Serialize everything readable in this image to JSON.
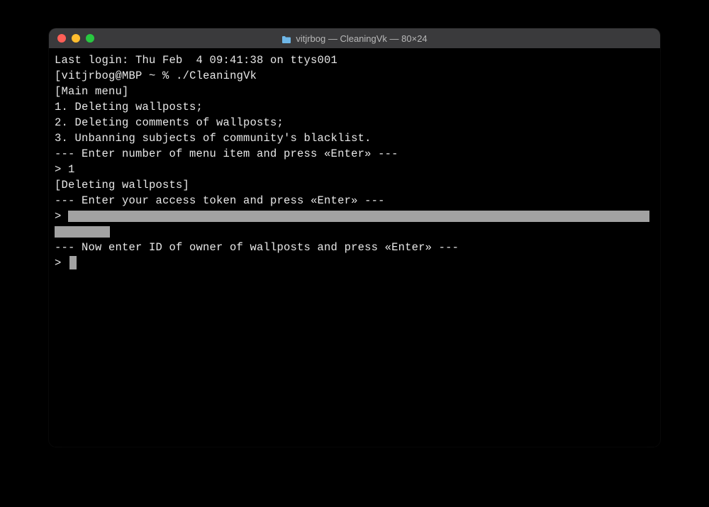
{
  "window": {
    "title": "vitjrbog — CleaningVk — 80×24"
  },
  "terminal": {
    "last_login": "Last login: Thu Feb  4 09:41:38 on ttys001",
    "prompt_prefix": "[",
    "prompt_user_host": "vitjrbog@MBP",
    "prompt_path": " ~ % ",
    "command": "./CleaningVk",
    "blank1": "",
    "main_menu_header": "[Main menu]",
    "menu_item_1": "1. Deleting wallposts;",
    "menu_item_2": "2. Deleting comments of wallposts;",
    "menu_item_3": "3. Unbanning subjects of community's blacklist.",
    "prompt_enter_menu": "--- Enter number of menu item and press «Enter» ---",
    "input_menu": "> 1",
    "deleting_header": "[Deleting wallposts]",
    "prompt_enter_token": "--- Enter your access token and press «Enter» ---",
    "input_token_prefix": "> ",
    "prompt_enter_owner": "--- Now enter ID of owner of wallposts and press «Enter» ---",
    "input_owner_prefix": "> "
  }
}
